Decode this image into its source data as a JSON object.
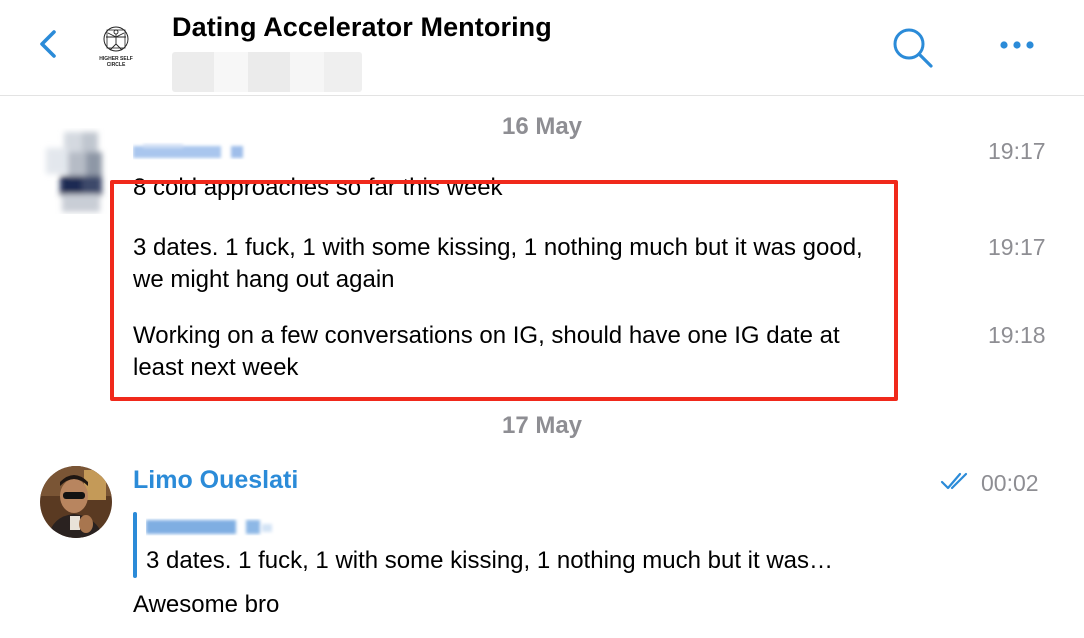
{
  "header": {
    "title": "Dating Accelerator Mentoring",
    "subtitle_blurred": "",
    "logo_text": "HIGHER SELF CIRCLE",
    "icons": {
      "back": "chevron-left-icon",
      "search": "search-icon",
      "more": "more-horizontal-icon"
    },
    "accent_color": "#2b8bd8"
  },
  "chat": {
    "date_separators": [
      "16 May",
      "17 May"
    ],
    "messages": [
      {
        "sender": "",
        "text": "8 cold approaches so far this week",
        "time": "19:17"
      },
      {
        "sender": "",
        "text": "3 dates. 1 fuck, 1 with some kissing, 1 nothing much but it was good, we might hang out again",
        "time": "19:17"
      },
      {
        "sender": "",
        "text": "Working on a few conversations on IG, should have one IG date at least next week",
        "time": "19:18"
      }
    ],
    "reply_message": {
      "sender": "Limo Oueslati",
      "time": "00:02",
      "status": "read",
      "quoted_author": "",
      "quoted_text": "3 dates. 1 fuck, 1 with some kissing, 1 nothing much but it was…",
      "text": "Awesome bro"
    }
  },
  "highlight_color": "#f0291b"
}
